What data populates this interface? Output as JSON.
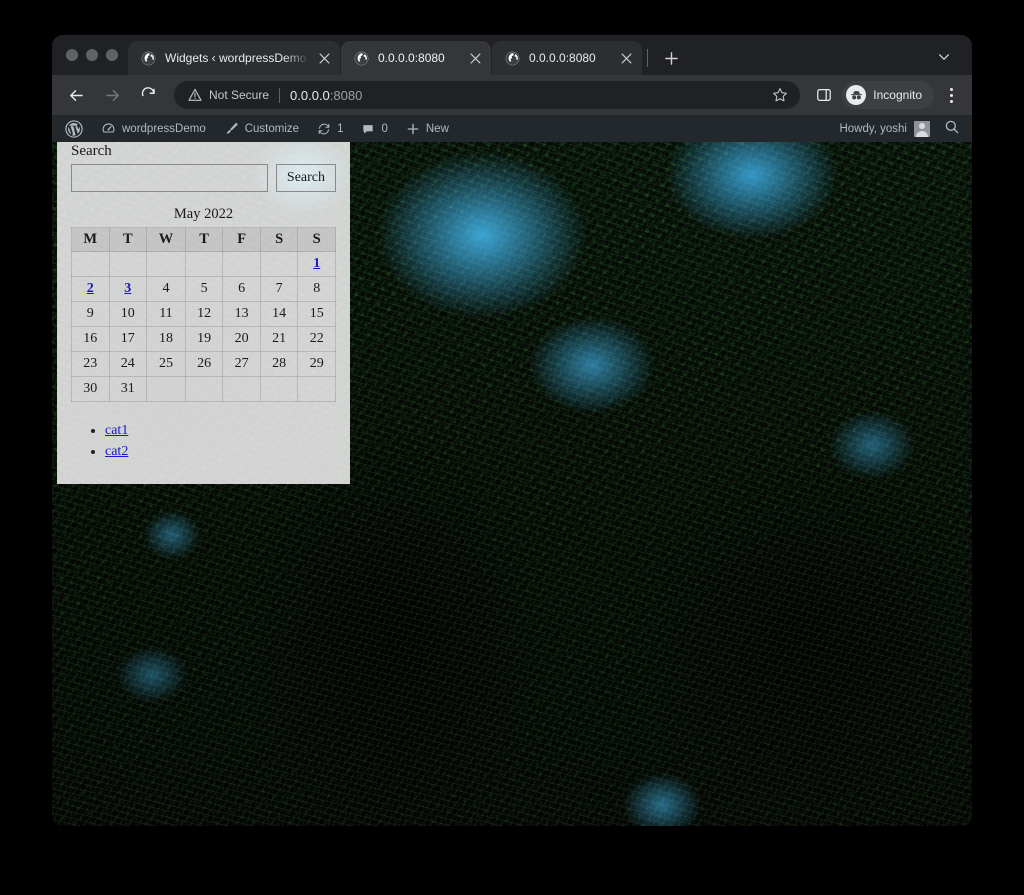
{
  "window": {
    "traffic_lights": [
      "close",
      "minimize",
      "maximize"
    ]
  },
  "tabs": [
    {
      "title": "Widgets ‹ wordpressDemo — W",
      "favicon": "globe-icon",
      "active": false
    },
    {
      "title": "0.0.0.0:8080",
      "favicon": "globe-icon",
      "active": true
    },
    {
      "title": "0.0.0.0:8080",
      "favicon": "globe-icon",
      "active": false
    }
  ],
  "tabstrip": {
    "new_tab_label": "+",
    "chevron_label": "⌄"
  },
  "toolbar": {
    "back_label": "←",
    "forward_label": "→",
    "reload_label": "⟳",
    "security_text": "Not Secure",
    "url_host": "0.0.0.0",
    "url_port": ":8080",
    "bookmark_icon": "star-icon",
    "side_panel_icon": "side-panel-icon",
    "profile_label": "Incognito",
    "menu_icon": "kebab-menu-icon"
  },
  "adminbar": {
    "wp_logo": "wordpress-logo-icon",
    "site_name": "wordpressDemo",
    "customize": "Customize",
    "updates_count": "1",
    "comments_count": "0",
    "new_label": "New",
    "howdy": "Howdy, yoshi",
    "search_icon": "search-icon"
  },
  "widgets": {
    "search": {
      "label": "Search",
      "input_value": "",
      "input_placeholder": "",
      "button_label": "Search"
    },
    "calendar": {
      "caption": "May 2022",
      "day_headers": [
        "M",
        "T",
        "W",
        "T",
        "F",
        "S",
        "S"
      ],
      "weeks": [
        [
          {
            "d": "",
            "link": false
          },
          {
            "d": "",
            "link": false
          },
          {
            "d": "",
            "link": false
          },
          {
            "d": "",
            "link": false
          },
          {
            "d": "",
            "link": false
          },
          {
            "d": "",
            "link": false
          },
          {
            "d": "1",
            "link": true
          }
        ],
        [
          {
            "d": "2",
            "link": true
          },
          {
            "d": "3",
            "link": true
          },
          {
            "d": "4",
            "link": false
          },
          {
            "d": "5",
            "link": false
          },
          {
            "d": "6",
            "link": false
          },
          {
            "d": "7",
            "link": false
          },
          {
            "d": "8",
            "link": false
          }
        ],
        [
          {
            "d": "9",
            "link": false
          },
          {
            "d": "10",
            "link": false
          },
          {
            "d": "11",
            "link": false
          },
          {
            "d": "12",
            "link": false
          },
          {
            "d": "13",
            "link": false
          },
          {
            "d": "14",
            "link": false
          },
          {
            "d": "15",
            "link": false
          }
        ],
        [
          {
            "d": "16",
            "link": false
          },
          {
            "d": "17",
            "link": false
          },
          {
            "d": "18",
            "link": false
          },
          {
            "d": "19",
            "link": false
          },
          {
            "d": "20",
            "link": false
          },
          {
            "d": "21",
            "link": false
          },
          {
            "d": "22",
            "link": false
          }
        ],
        [
          {
            "d": "23",
            "link": false
          },
          {
            "d": "24",
            "link": false
          },
          {
            "d": "25",
            "link": false
          },
          {
            "d": "26",
            "link": false
          },
          {
            "d": "27",
            "link": false
          },
          {
            "d": "28",
            "link": false
          },
          {
            "d": "29",
            "link": false
          }
        ],
        [
          {
            "d": "30",
            "link": false
          },
          {
            "d": "31",
            "link": false
          },
          {
            "d": "",
            "link": false
          },
          {
            "d": "",
            "link": false
          },
          {
            "d": "",
            "link": false
          },
          {
            "d": "",
            "link": false
          },
          {
            "d": "",
            "link": false
          }
        ]
      ]
    },
    "categories": [
      {
        "label": "cat1"
      },
      {
        "label": "cat2"
      }
    ]
  },
  "colors": {
    "chrome_toolbar": "#35363a",
    "chrome_tabstrip": "#202124",
    "omnibox": "#202124",
    "wp_adminbar": "#23282d",
    "link": "#1818c8",
    "widget_overlay": "rgba(255,255,255,0.82)"
  }
}
